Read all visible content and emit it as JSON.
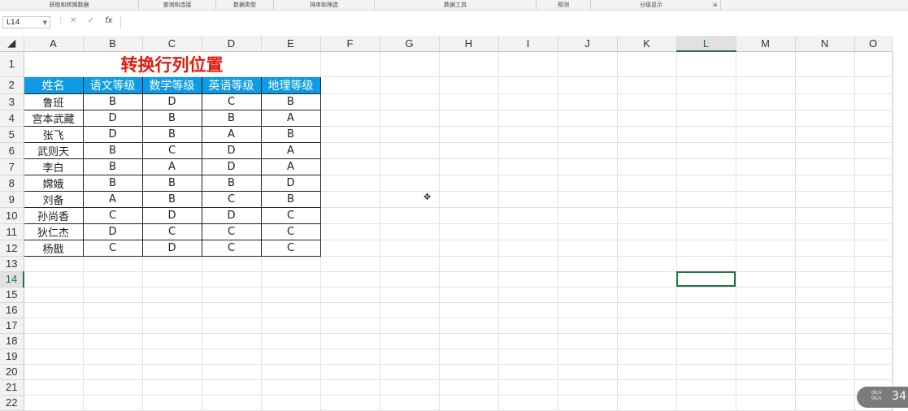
{
  "ribbon": {
    "groups": [
      "获取和转换数据",
      "查询和连接",
      "数据类型",
      "排序和筛选",
      "数据工具",
      "预测",
      "分级显示"
    ],
    "launcher": "⇲"
  },
  "formula_bar": {
    "name_box": "L14",
    "cancel": "✕",
    "enter": "✓",
    "fx": "fx",
    "content": ""
  },
  "columns": [
    "A",
    "B",
    "C",
    "D",
    "E",
    "F",
    "G",
    "H",
    "I",
    "J",
    "K",
    "L",
    "M",
    "N",
    "O"
  ],
  "active_cell": "L14",
  "sheet": {
    "title": "转换行列位置",
    "headers": [
      "姓名",
      "语文等级",
      "数学等级",
      "英语等级",
      "地理等级"
    ],
    "rows": [
      [
        "鲁班",
        "B",
        "D",
        "C",
        "B"
      ],
      [
        "宫本武藏",
        "D",
        "B",
        "B",
        "A"
      ],
      [
        "张飞",
        "D",
        "B",
        "A",
        "B"
      ],
      [
        "武则天",
        "B",
        "C",
        "D",
        "A"
      ],
      [
        "李白",
        "B",
        "A",
        "D",
        "A"
      ],
      [
        "嫦娥",
        "B",
        "B",
        "B",
        "D"
      ],
      [
        "刘备",
        "A",
        "B",
        "C",
        "B"
      ],
      [
        "孙尚香",
        "C",
        "D",
        "D",
        "C"
      ],
      [
        "狄仁杰",
        "D",
        "C",
        "C",
        "C"
      ],
      [
        "杨戬",
        "C",
        "D",
        "C",
        "C"
      ]
    ]
  },
  "row_numbers": [
    "1",
    "2",
    "3",
    "4",
    "5",
    "6",
    "7",
    "8",
    "9",
    "10",
    "11",
    "12",
    "13",
    "14",
    "15",
    "16",
    "17",
    "18",
    "19",
    "20",
    "21",
    "22"
  ],
  "overlay": {
    "badge_number": "34",
    "badge_small_1": "0k/s",
    "badge_small_2": "0k/s"
  }
}
